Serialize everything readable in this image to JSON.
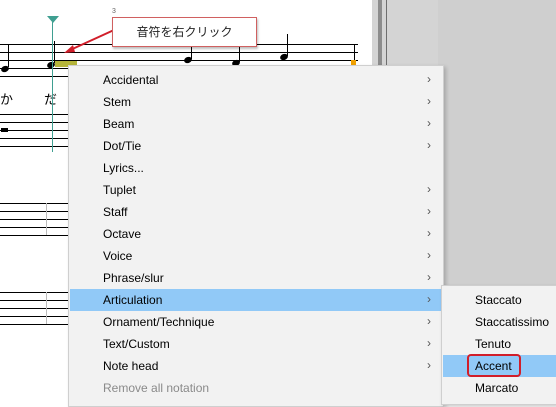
{
  "callout": {
    "text": "音符を右クリック"
  },
  "score": {
    "lyrics": [
      "か",
      "だ"
    ],
    "measure_number": "3"
  },
  "context_menu": {
    "items": [
      {
        "label": "Accidental",
        "submenu": true
      },
      {
        "label": "Stem",
        "submenu": true
      },
      {
        "label": "Beam",
        "submenu": true
      },
      {
        "label": "Dot/Tie",
        "submenu": true
      },
      {
        "label": "Lyrics...",
        "submenu": false
      },
      {
        "label": "Tuplet",
        "submenu": true
      },
      {
        "label": "Staff",
        "submenu": true
      },
      {
        "label": "Octave",
        "submenu": true
      },
      {
        "label": "Voice",
        "submenu": true
      },
      {
        "label": "Phrase/slur",
        "submenu": true
      },
      {
        "label": "Articulation",
        "submenu": true,
        "active": true
      },
      {
        "label": "Ornament/Technique",
        "submenu": true
      },
      {
        "label": "Text/Custom",
        "submenu": true
      },
      {
        "label": "Note head",
        "submenu": true
      },
      {
        "label": "Remove all notation",
        "submenu": false,
        "disabled": true
      }
    ],
    "chevron": "›"
  },
  "articulation_submenu": {
    "items": [
      {
        "label": "Staccato"
      },
      {
        "label": "Staccatissimo"
      },
      {
        "label": "Tenuto"
      },
      {
        "label": "Accent",
        "active": true
      },
      {
        "label": "Marcato"
      }
    ]
  },
  "colors": {
    "highlight": "#91c9f7",
    "accent_outline": "#d11e2a",
    "cursor": "#3f9f91"
  }
}
